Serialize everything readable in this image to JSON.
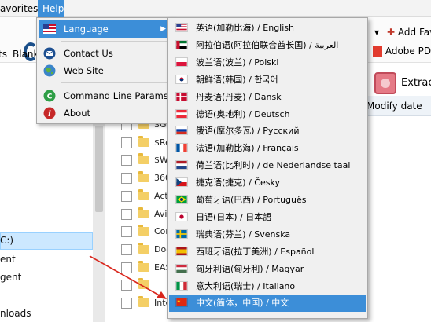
{
  "menubar": {
    "favorites": "avorites",
    "help": "Help"
  },
  "toolbar": {
    "tasks": "ts",
    "blank": "Blank p",
    "add_fav": "Add Fav",
    "adobe_pdf": "Adobe PDF",
    "extract": "Extract",
    "modify_date": "Modify date"
  },
  "tree": {
    "drive": "C:)",
    "item1": "ent",
    "item2": "gent",
    "item3": "nloads"
  },
  "list_rows": [
    "$Ge",
    "$Re",
    "$W",
    "360",
    "Act",
    "Avi",
    "Cor",
    "Doc",
    "EAS",
    "",
    "Intel"
  ],
  "help_menu": {
    "language": "Language",
    "contact": "Contact Us",
    "website": "Web Site",
    "cmdline": "Command Line Params",
    "about": "About"
  },
  "languages": [
    {
      "label": "英语(加勒比海) / English",
      "flag": "us"
    },
    {
      "label": "阿拉伯语(阿拉伯联合酋长国) / العربية",
      "flag": "ae"
    },
    {
      "label": "波兰语(波兰) / Polski",
      "flag": "pl"
    },
    {
      "label": "朝鲜语(韩国) / 한국어",
      "flag": "kr"
    },
    {
      "label": "丹麦语(丹麦) / Dansk",
      "flag": "dk"
    },
    {
      "label": "德语(奥地利) / Deutsch",
      "flag": "at"
    },
    {
      "label": "俄语(摩尔多瓦) / Русский",
      "flag": "ru"
    },
    {
      "label": "法语(加勒比海) / Français",
      "flag": "fr"
    },
    {
      "label": "荷兰语(比利时) / de Nederlandse taal",
      "flag": "nl"
    },
    {
      "label": "捷克语(捷克) / Česky",
      "flag": "cz"
    },
    {
      "label": "葡萄牙语(巴西) / Português",
      "flag": "br"
    },
    {
      "label": "日语(日本) / 日本語",
      "flag": "jp"
    },
    {
      "label": "瑞典语(芬兰) / Svenska",
      "flag": "se"
    },
    {
      "label": "西班牙语(拉丁美洲) / Español",
      "flag": "es"
    },
    {
      "label": "匈牙利语(匈牙利) / Magyar",
      "flag": "hu"
    },
    {
      "label": "意大利语(瑞士) / Italiano",
      "flag": "it"
    },
    {
      "label": "中文(简体，中国) / 中文",
      "flag": "cn"
    }
  ],
  "colors": {
    "highlight": "#3c8ed8",
    "arrow": "#d9261c"
  }
}
